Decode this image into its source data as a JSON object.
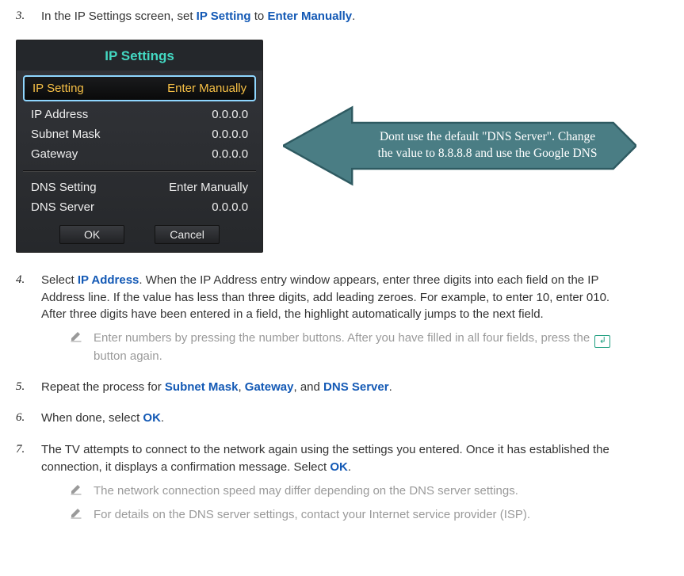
{
  "steps": {
    "s3_a": "In the IP Settings screen, set ",
    "s3_b": "IP Setting",
    "s3_c": " to ",
    "s3_d": "Enter Manually",
    "s3_e": ".",
    "s4_a": "Select ",
    "s4_b": "IP Address",
    "s4_c": ". When the IP Address entry window appears, enter three digits into each field on the IP Address line. If the value has less than three digits, add leading zeroes. For example, to enter 10, enter 010. After three digits have been entered in a field, the highlight automatically jumps to the next field.",
    "s5_a": "Repeat the process for ",
    "s5_b": "Subnet Mask",
    "s5_c": ", ",
    "s5_d": "Gateway",
    "s5_e": ", and ",
    "s5_f": "DNS Server",
    "s5_g": ".",
    "s6_a": "When done, select ",
    "s6_b": "OK",
    "s6_c": ".",
    "s7_a": "The TV attempts to connect to the network again using the settings you entered. Once it has established the connection, it displays a confirmation message. Select ",
    "s7_b": "OK",
    "s7_c": "."
  },
  "notes": {
    "n1_a": "Enter numbers by pressing the number buttons. After you have filled in all four fields, press the ",
    "n1_b": " button again.",
    "n2": "The network connection speed may differ depending on the DNS server settings.",
    "n3": "For details on the DNS server settings, contact your Internet service provider (ISP)."
  },
  "panel": {
    "title": "IP Settings",
    "rows": [
      {
        "label": "IP Setting",
        "value": "Enter Manually",
        "highlight": true
      },
      {
        "label": "IP Address",
        "value": "0.0.0.0"
      },
      {
        "label": "Subnet Mask",
        "value": "0.0.0.0"
      },
      {
        "label": "Gateway",
        "value": "0.0.0.0"
      }
    ],
    "rows2": [
      {
        "label": "DNS Setting",
        "value": "Enter Manually"
      },
      {
        "label": "DNS Server",
        "value": "0.0.0.0"
      }
    ],
    "ok": "OK",
    "cancel": "Cancel"
  },
  "callout": "Dont use the default \"DNS Server\". Change the value to 8.8.8.8 and use the Google DNS",
  "colors": {
    "link": "#1359b5",
    "teal": "#4a7d84",
    "tealBorder": "#2e5a61",
    "panelTitle": "#43d8c2",
    "highlightText": "#f7c046"
  }
}
